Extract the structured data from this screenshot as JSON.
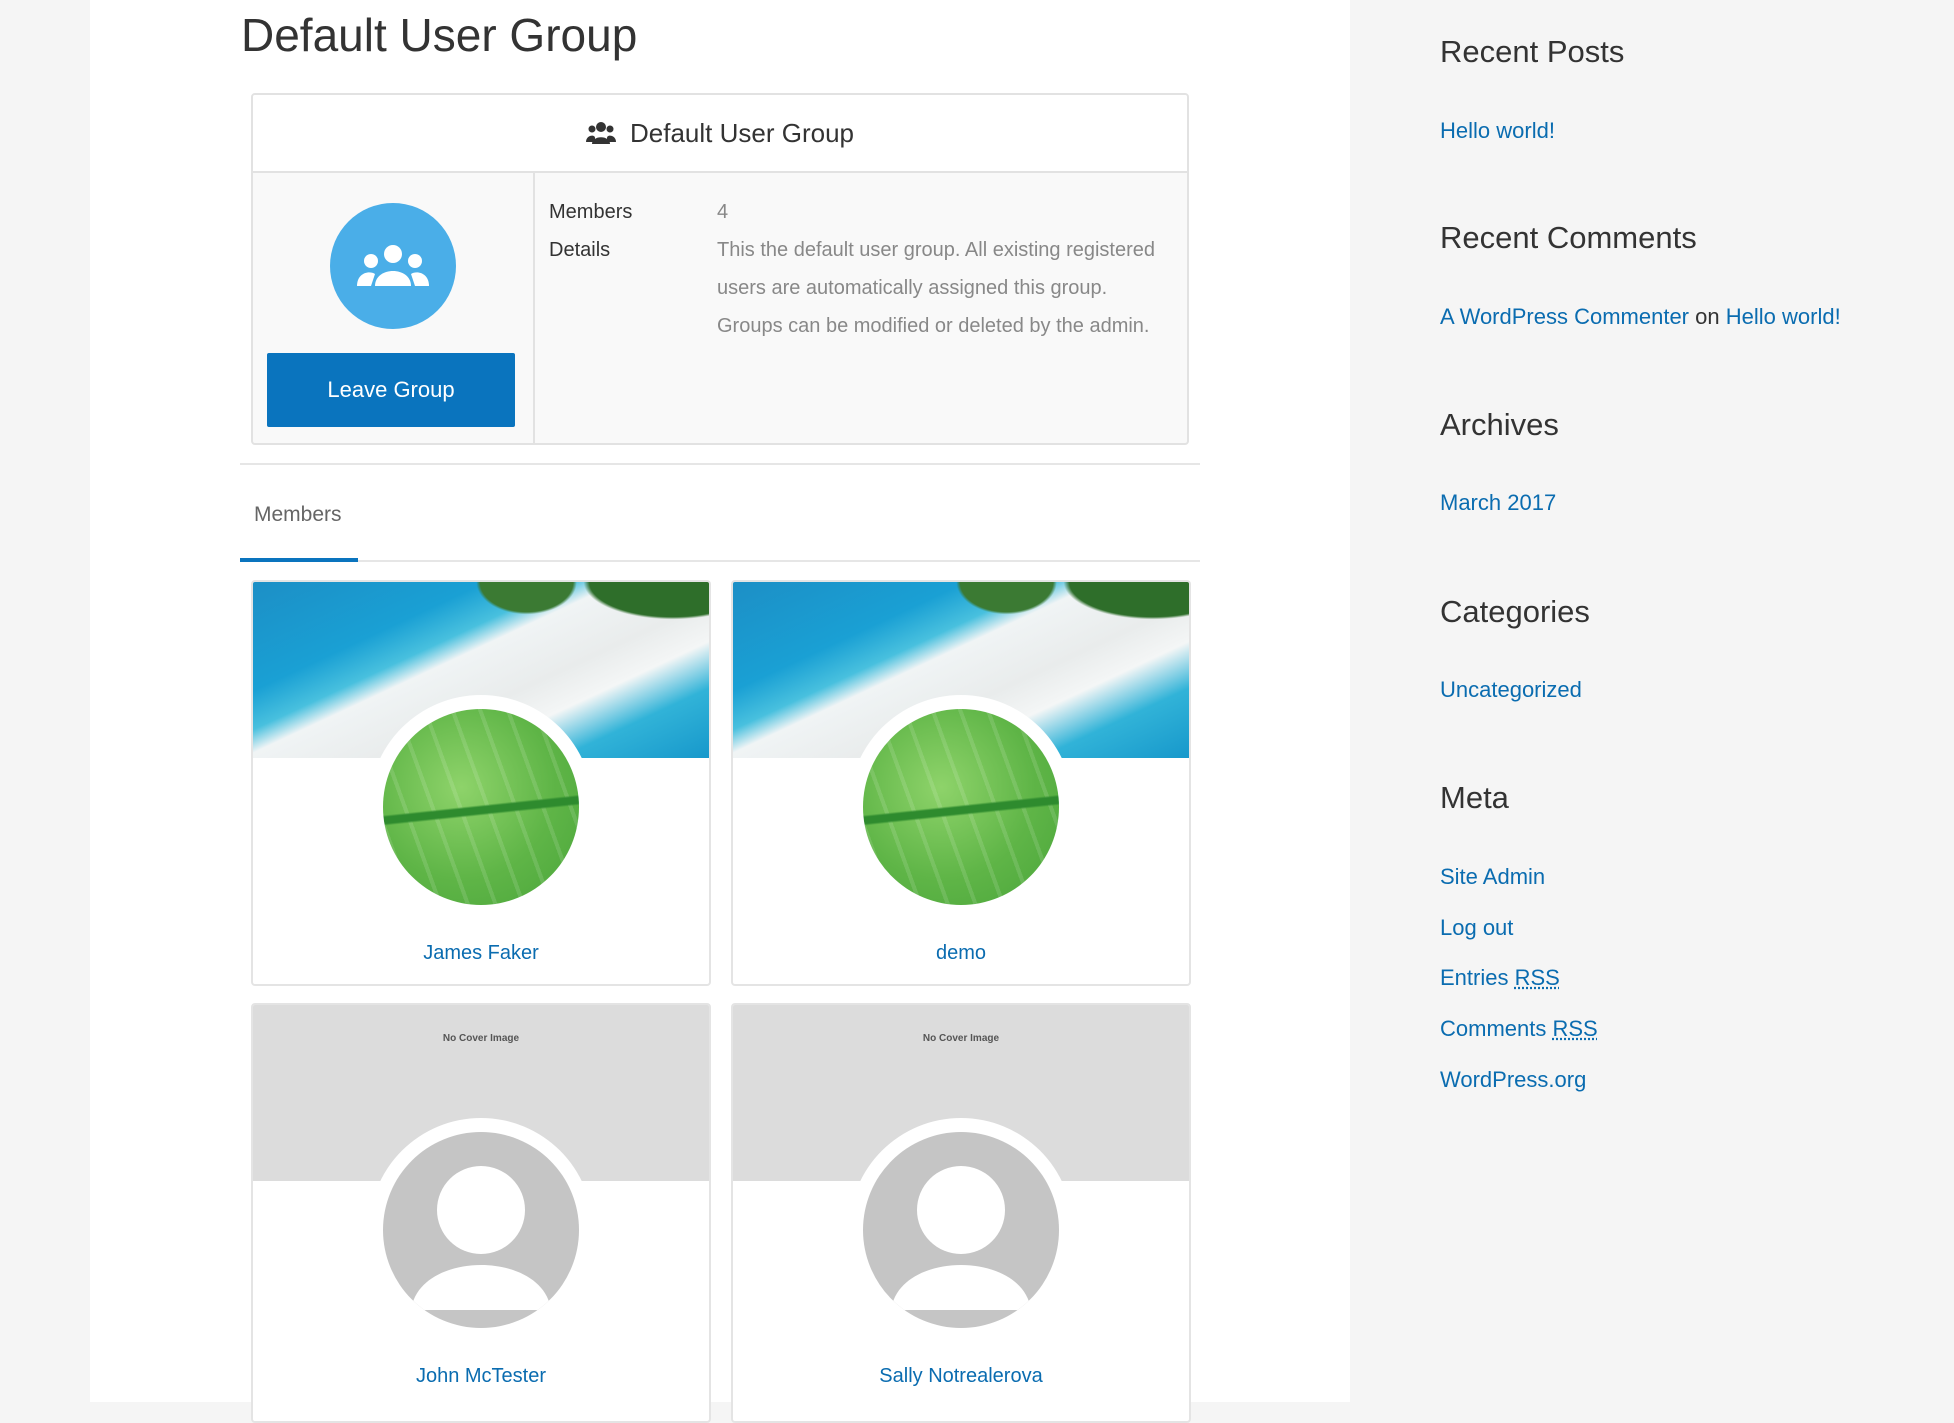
{
  "page": {
    "title": "Default User Group"
  },
  "group": {
    "header_title": "Default User Group",
    "header_icon": "users-icon",
    "avatar_icon": "group-icon",
    "leave_label": "Leave Group",
    "members_label": "Members",
    "members_value": "4",
    "details_label": "Details",
    "details_value": "This the default user group. All existing registered users are automatically assigned this group. Groups can be modified or deleted by the admin.",
    "accent_color": "#0a74be",
    "avatar_color": "#4aaee8"
  },
  "tabs": [
    {
      "label": "Members",
      "active": true
    }
  ],
  "members": [
    {
      "name": "James Faker",
      "cover": "beach",
      "avatar": "leaf"
    },
    {
      "name": "demo",
      "cover": "beach",
      "avatar": "leaf"
    },
    {
      "name": "John McTester",
      "cover": "none",
      "cover_text": "No Cover Image",
      "avatar": "default"
    },
    {
      "name": "Sally Notrealerova",
      "cover": "none",
      "cover_text": "No Cover Image",
      "avatar": "default"
    }
  ],
  "sidebar": {
    "recent_posts": {
      "title": "Recent Posts",
      "items": [
        "Hello world!"
      ]
    },
    "recent_comments": {
      "title": "Recent Comments",
      "author": "A WordPress Commenter",
      "joiner": "on",
      "post": "Hello world!"
    },
    "archives": {
      "title": "Archives",
      "items": [
        "March 2017"
      ]
    },
    "categories": {
      "title": "Categories",
      "items": [
        "Uncategorized"
      ]
    },
    "meta": {
      "title": "Meta",
      "site_admin": "Site Admin",
      "log_out": "Log out",
      "entries": "Entries",
      "comments": "Comments",
      "rss": "RSS",
      "wordpress_org": "WordPress.org"
    }
  },
  "colors": {
    "link": "#0a6cb0",
    "text": "#333333"
  }
}
